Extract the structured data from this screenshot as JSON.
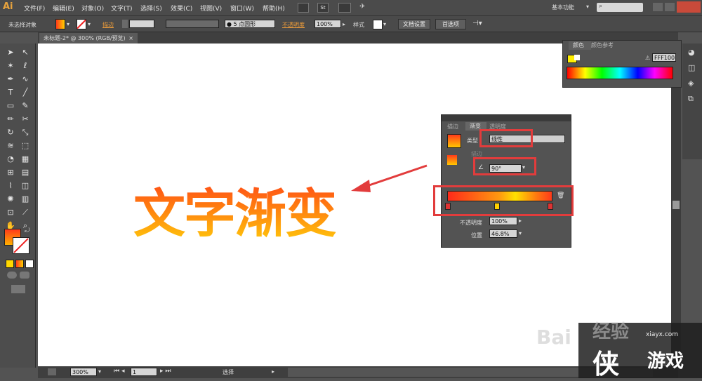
{
  "app": {
    "logo": "Ai"
  },
  "menu": [
    "文件(F)",
    "编辑(E)",
    "对象(O)",
    "文字(T)",
    "选择(S)",
    "效果(C)",
    "视图(V)",
    "窗口(W)",
    "帮助(H)"
  ],
  "menu_extra": {
    "st_label": "St",
    "workspace": "基本功能",
    "search_placeholder": ""
  },
  "control": {
    "selection": "未选择对象",
    "stroke_label": "描边",
    "brush": "5 点圆形",
    "opacity_label": "不透明度",
    "opacity_value": "100%",
    "style_label": "样式",
    "doc_setup": "文档设置",
    "prefs": "首选项"
  },
  "document": {
    "tab_title": "未标题-2* @ 300% (RGB/预览)",
    "artwork_text": "文字渐变"
  },
  "status": {
    "zoom": "300%",
    "page": "1",
    "mode": "选择"
  },
  "color_panel": {
    "tab1": "颜色",
    "tab2": "颜色参考",
    "hex": "FFF100"
  },
  "gradient_panel": {
    "tabs": [
      "描边",
      "渐变",
      "透明度"
    ],
    "type_label": "类型",
    "type_value": "线性",
    "stroke_label": "描边",
    "angle_value": "90°",
    "opacity_label": "不透明度",
    "opacity_value": "100%",
    "position_label": "位置",
    "position_value": "46.8%"
  },
  "watermark": {
    "brand": "Bai",
    "site": "xiayx.com",
    "cn": "游戏",
    "exp": "经验"
  },
  "colors": {
    "accent_red": "#e23c3c",
    "canvas": "#ffffff",
    "ui_dark": "#535353"
  }
}
